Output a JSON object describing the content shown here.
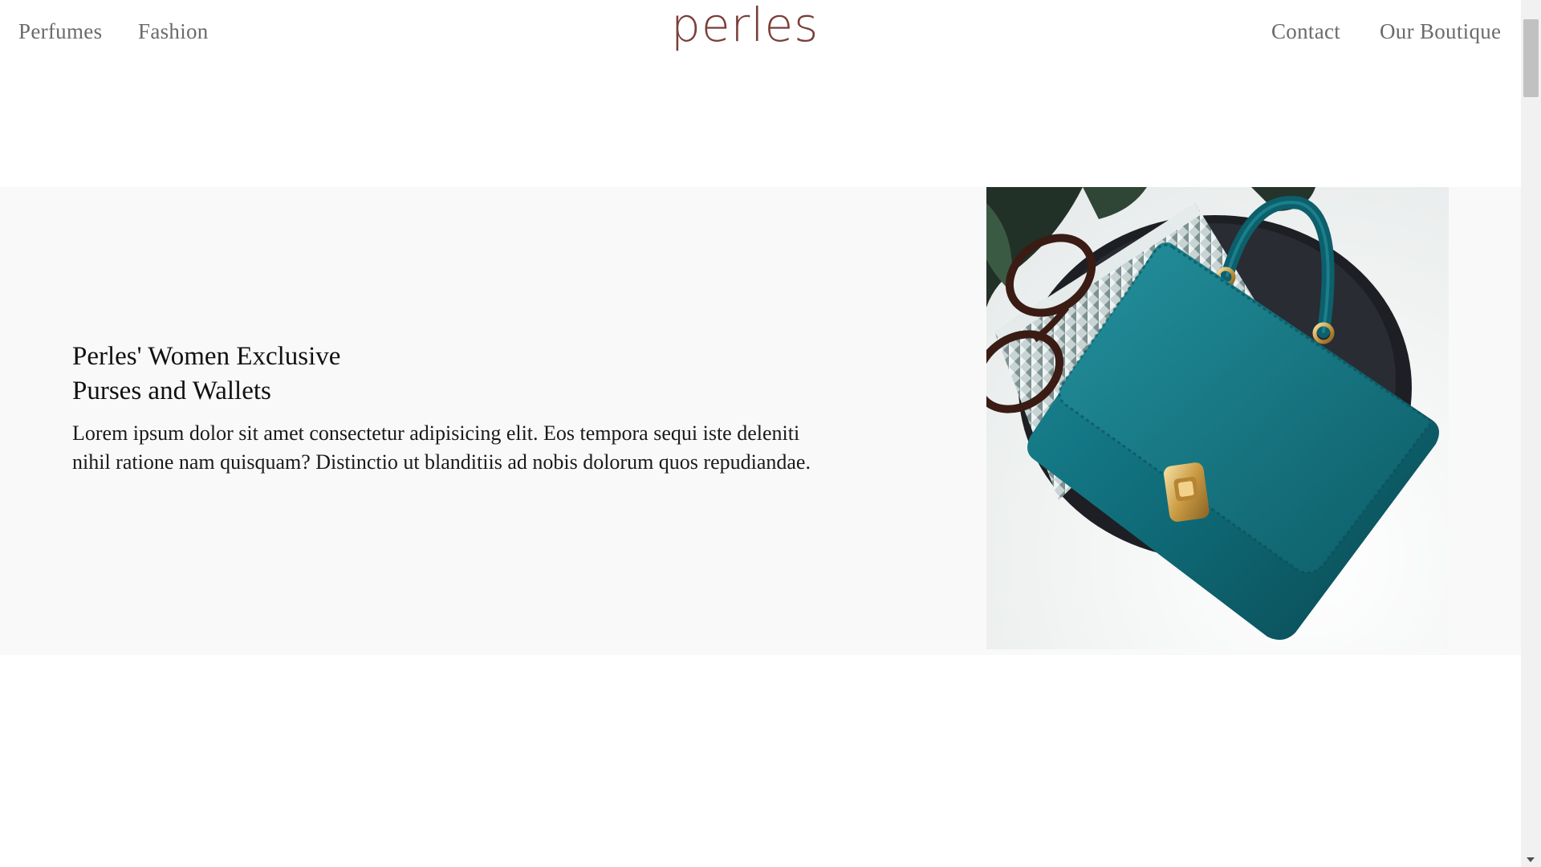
{
  "header": {
    "nav_left": [
      "Perfumes",
      "Fashion"
    ],
    "logo": "perles",
    "nav_right": [
      "Contact",
      "Our Boutique"
    ]
  },
  "feature": {
    "heading_line1": "Perles' Women Exclusive",
    "heading_line2": "Purses and Wallets",
    "body": "Lorem ipsum dolor sit amet consectetur adipisicing elit. Eos tempora sequi iste deleniti nihil ratione nam quisquam? Distinctio ut blanditiis ad nobis dolorum quos repudiandae."
  },
  "colors": {
    "brand": "#7a3f3a",
    "nav_text": "#6b6b6b",
    "band_bg": "#f9f9f9",
    "bag": "#0d5f6c"
  },
  "icons": {
    "scroll_down": "chevron-down-icon"
  }
}
